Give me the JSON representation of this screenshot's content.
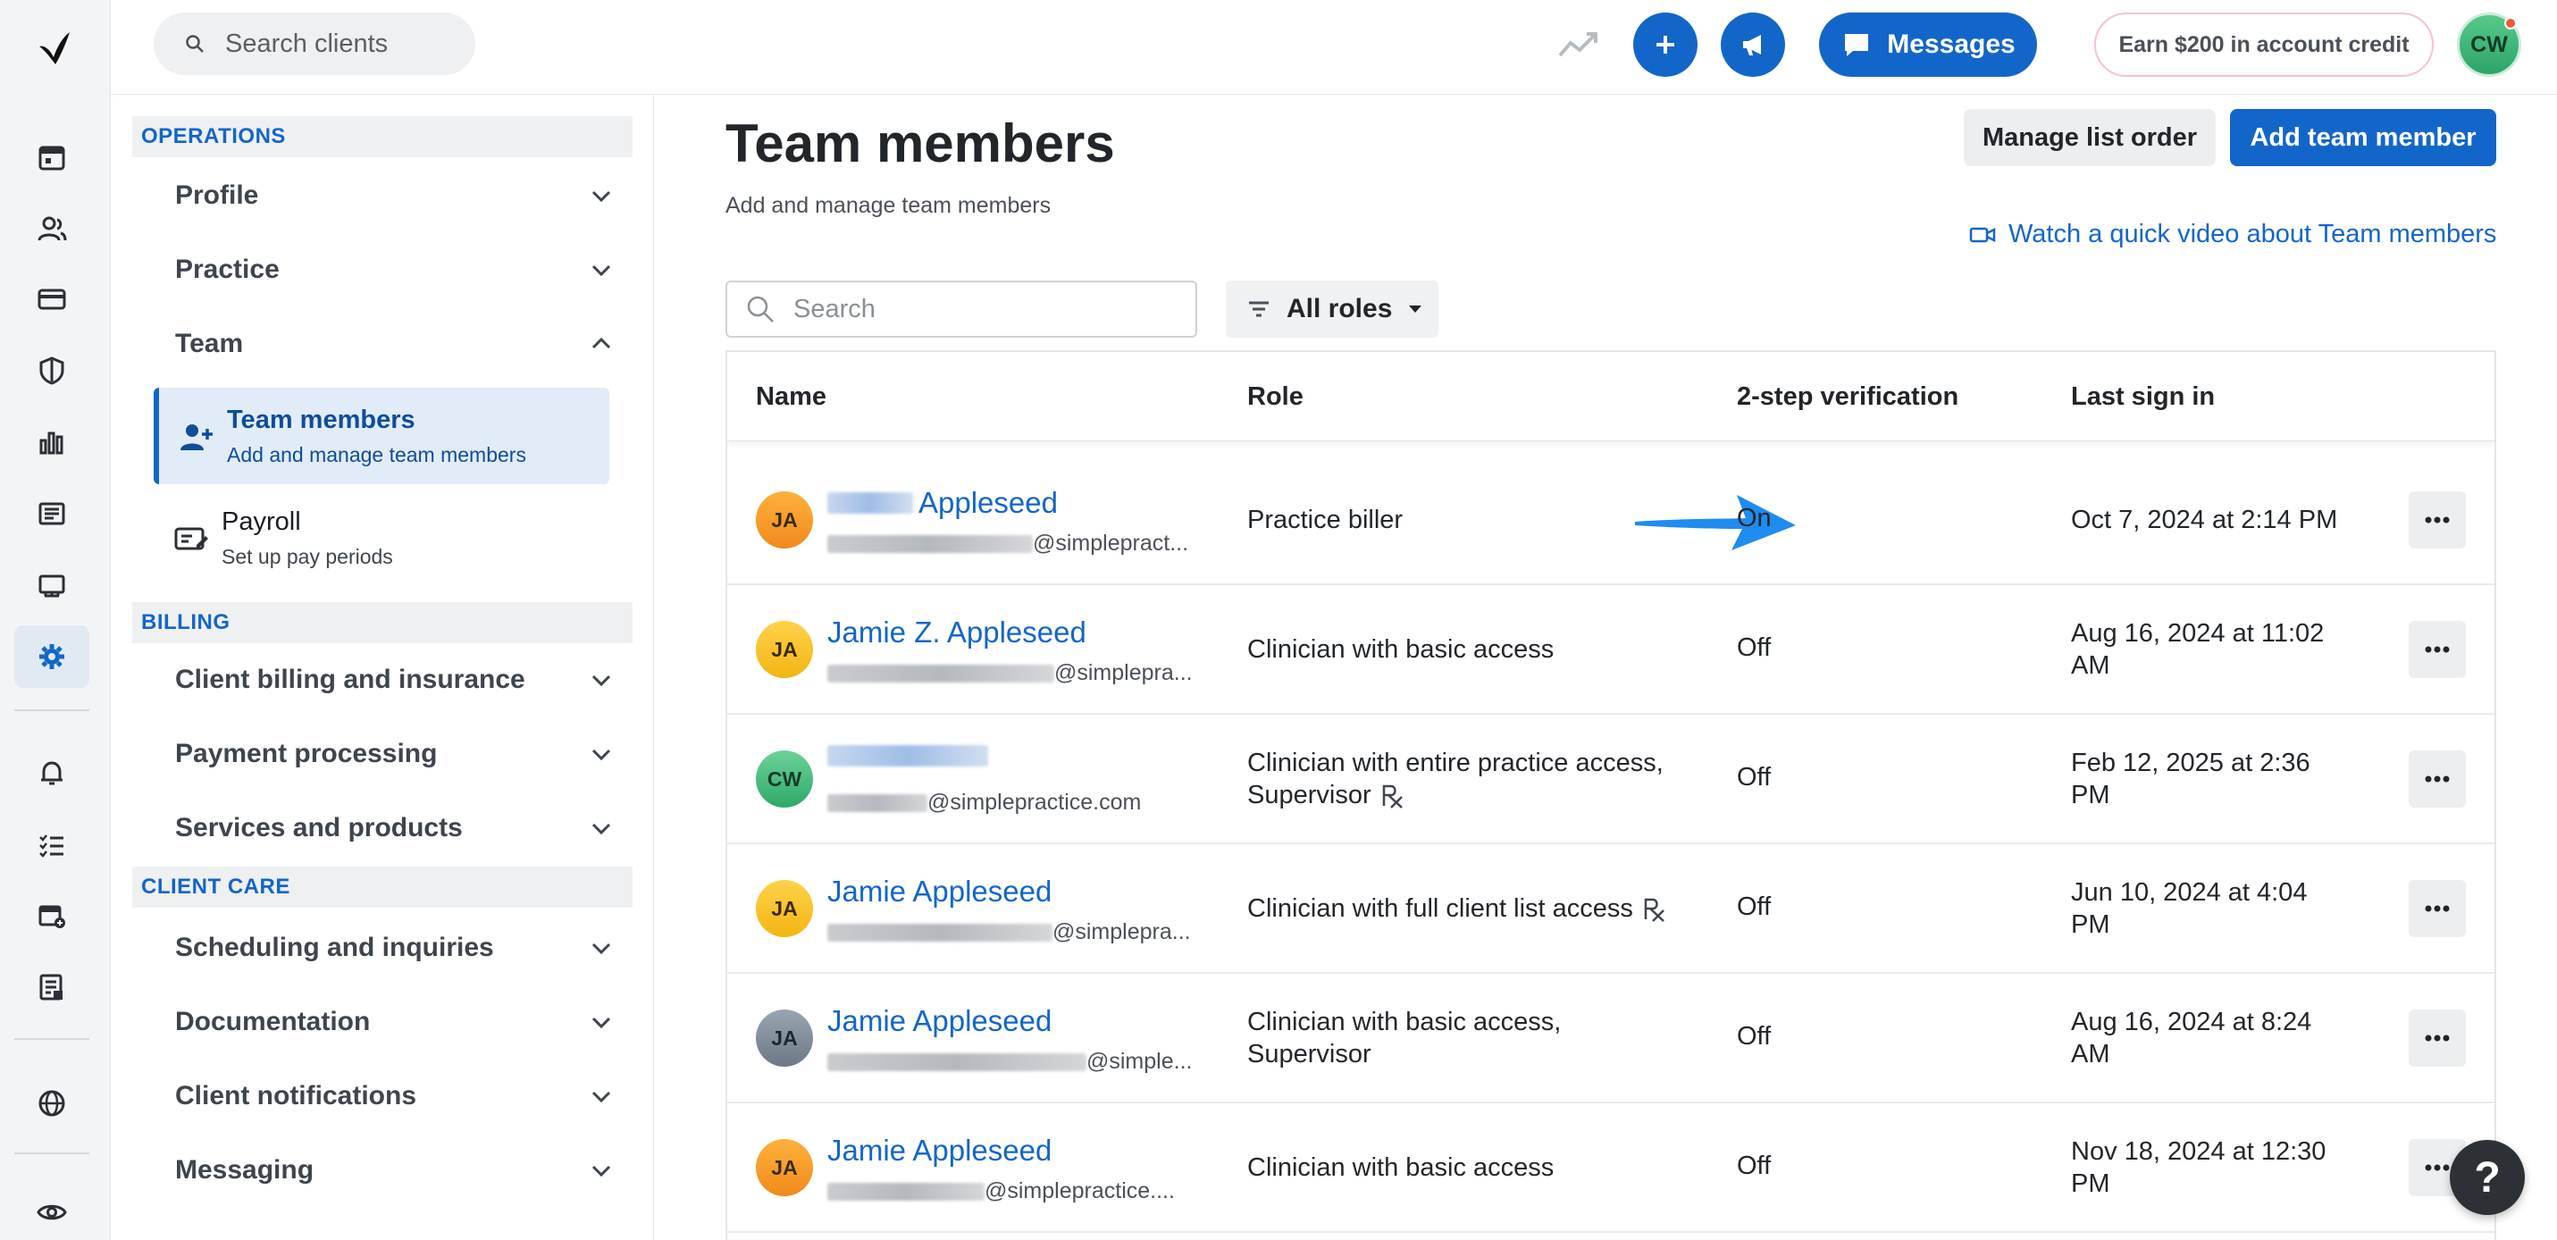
{
  "topbar": {
    "search_placeholder": "Search clients",
    "messages_label": "Messages",
    "earn_label": "Earn $200 in account credit",
    "avatar_initials": "CW"
  },
  "subnav": {
    "operations_header": "OPERATIONS",
    "profile": "Profile",
    "practice": "Practice",
    "team": "Team",
    "team_members_title": "Team members",
    "team_members_sub": "Add and manage team members",
    "payroll_title": "Payroll",
    "payroll_sub": "Set up pay periods",
    "billing_header": "BILLING",
    "client_billing": "Client billing and insurance",
    "payment_processing": "Payment processing",
    "services_products": "Services and products",
    "client_care_header": "CLIENT CARE",
    "scheduling": "Scheduling and inquiries",
    "documentation": "Documentation",
    "client_notifications": "Client notifications",
    "messaging": "Messaging"
  },
  "main": {
    "title": "Team members",
    "subtitle": "Add and manage team members",
    "manage_btn": "Manage list order",
    "add_btn": "Add team member",
    "video_link": "Watch a quick video about Team members",
    "search_placeholder": "Search",
    "roles_filter": "All roles"
  },
  "table": {
    "headers": [
      "Name",
      "Role",
      "2-step verification",
      "Last sign in"
    ],
    "rows": [
      {
        "initials": "JA",
        "name": "Appleseed",
        "email": "@simplepract...",
        "role_line1": "Practice biller",
        "role_line2": "",
        "verification": "On",
        "signin_line1": "Oct 7, 2024 at 2:14 PM",
        "signin_line2": ""
      },
      {
        "initials": "JA",
        "name": "Jamie Z. Appleseed",
        "email": "@simplepra...",
        "role_line1": "Clinician with basic access",
        "role_line2": "",
        "verification": "Off",
        "signin_line1": "Aug 16, 2024 at 11:02",
        "signin_line2": "AM"
      },
      {
        "initials": "CW",
        "name": "",
        "email": "@simplepractice.com",
        "role_line1": "Clinician with entire practice access,",
        "role_line2": "Supervisor",
        "verification": "Off",
        "signin_line1": "Feb 12, 2025 at 2:36",
        "signin_line2": "PM"
      },
      {
        "initials": "JA",
        "name": "Jamie Appleseed",
        "email": "@simplepra...",
        "role_line1": "Clinician with full client list access",
        "role_line2": "",
        "verification": "Off",
        "signin_line1": "Jun 10, 2024 at 4:04",
        "signin_line2": "PM"
      },
      {
        "initials": "JA",
        "name": "Jamie Appleseed",
        "email": "@simple...",
        "role_line1": "Clinician with basic access,",
        "role_line2": "Supervisor",
        "verification": "Off",
        "signin_line1": "Aug 16, 2024 at 8:24",
        "signin_line2": "AM"
      },
      {
        "initials": "JA",
        "name": "Jamie Appleseed",
        "email": "@simplepractice....",
        "role_line1": "Clinician with basic access",
        "role_line2": "",
        "verification": "Off",
        "signin_line1": "Nov 18, 2024 at 12:30",
        "signin_line2": "PM"
      }
    ]
  },
  "help": "?",
  "colors": {
    "accent": "#1366c9",
    "arrow": "#1e8cf0"
  }
}
